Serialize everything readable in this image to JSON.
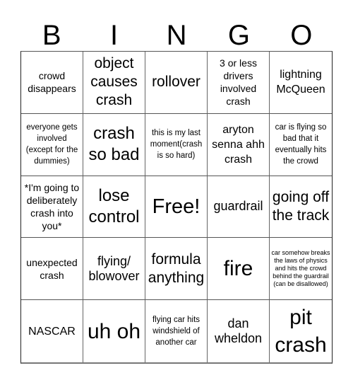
{
  "header": [
    "B",
    "I",
    "N",
    "G",
    "O"
  ],
  "cells": [
    {
      "text": "crowd disappears",
      "size": "s3"
    },
    {
      "text": "object causes crash",
      "size": "s6"
    },
    {
      "text": "rollover",
      "size": "s6"
    },
    {
      "text": "3 or less drivers involved crash",
      "size": "s3"
    },
    {
      "text": "lightning McQueen",
      "size": "s4"
    },
    {
      "text": "everyone gets involved (except for the dummies)",
      "size": "s2"
    },
    {
      "text": "crash so bad",
      "size": "s7"
    },
    {
      "text": "this is my last moment(crash is so hard)",
      "size": "s2"
    },
    {
      "text": "aryton senna ahh crash",
      "size": "s4"
    },
    {
      "text": "car is flying so bad that it eventually hits the crowd",
      "size": "s2"
    },
    {
      "text": "*I'm going to deliberately crash into you*",
      "size": "s3"
    },
    {
      "text": "lose control",
      "size": "s7"
    },
    {
      "text": "Free!",
      "size": "s8"
    },
    {
      "text": "guardrail",
      "size": "s5"
    },
    {
      "text": "going off the track",
      "size": "s6"
    },
    {
      "text": "unexpected crash",
      "size": "s3"
    },
    {
      "text": "flying/ blowover",
      "size": "s5"
    },
    {
      "text": "formula anything",
      "size": "s6"
    },
    {
      "text": "fire",
      "size": "s9"
    },
    {
      "text": "car somehow breaks the laws of physics and hits the crowd behind the guardrail (can be disallowed)",
      "size": "s1"
    },
    {
      "text": "NASCAR",
      "size": "s4"
    },
    {
      "text": "uh oh",
      "size": "s9"
    },
    {
      "text": "flying car hits windshield of another car",
      "size": "s2"
    },
    {
      "text": "dan wheldon",
      "size": "s5"
    },
    {
      "text": "pit crash",
      "size": "s9"
    }
  ]
}
